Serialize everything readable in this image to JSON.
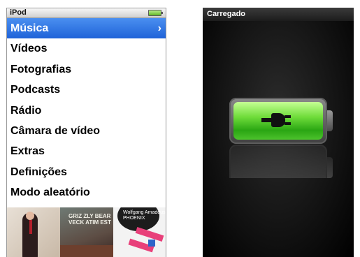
{
  "ipod": {
    "title": "iPod",
    "battery": "battery-charging-icon",
    "menu": [
      {
        "label": "Música",
        "selected": true
      },
      {
        "label": "Vídeos"
      },
      {
        "label": "Fotografias"
      },
      {
        "label": "Podcasts"
      },
      {
        "label": "Rádio"
      },
      {
        "label": "Câmara de vídeo"
      },
      {
        "label": "Extras"
      },
      {
        "label": "Definições"
      },
      {
        "label": "Modo aleatório"
      }
    ],
    "chevron": "›",
    "albums": {
      "cover2_text": "GRIZ ZLY BEAR VECK ATIM EST",
      "cover3_text": "Wolfgang Amadeus PHOENIX"
    }
  },
  "charging": {
    "status": "Carregado",
    "colors": {
      "fill": "#4cc22c",
      "accent": "#1f63d8"
    }
  }
}
